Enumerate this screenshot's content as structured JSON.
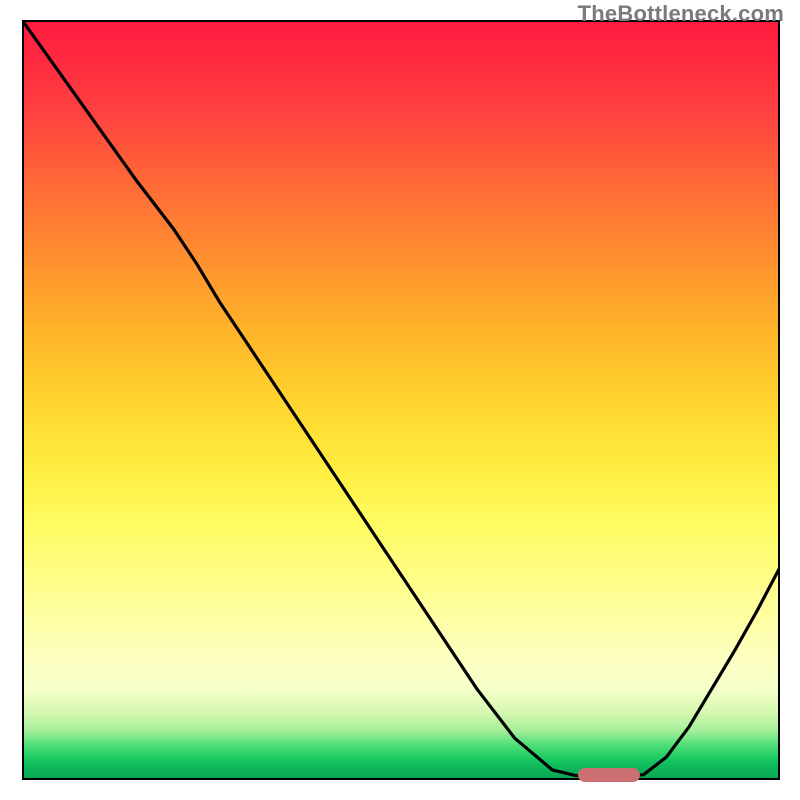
{
  "watermark": "TheBottleneck.com",
  "chart_data": {
    "type": "line",
    "title": "",
    "xlabel": "",
    "ylabel": "",
    "xlim": [
      0,
      100
    ],
    "ylim": [
      0,
      100
    ],
    "x": [
      0,
      5,
      10,
      15,
      20,
      23,
      26,
      30,
      35,
      40,
      45,
      50,
      55,
      60,
      65,
      70,
      73,
      76,
      79,
      82,
      85,
      88,
      91,
      94,
      97,
      100
    ],
    "y": [
      100,
      93,
      86,
      79,
      72.5,
      68,
      63,
      57,
      49.5,
      42,
      34.5,
      27,
      19.5,
      12,
      5.5,
      1.3,
      0.6,
      0.4,
      0.5,
      0.7,
      3,
      7,
      12,
      17,
      22.3,
      28
    ],
    "marker": {
      "x": 77.5,
      "y": 0.6
    },
    "grid": false,
    "legend": false
  },
  "colors": {
    "curve": "#000000",
    "marker": "#cc6f73",
    "frame": "#000000"
  }
}
